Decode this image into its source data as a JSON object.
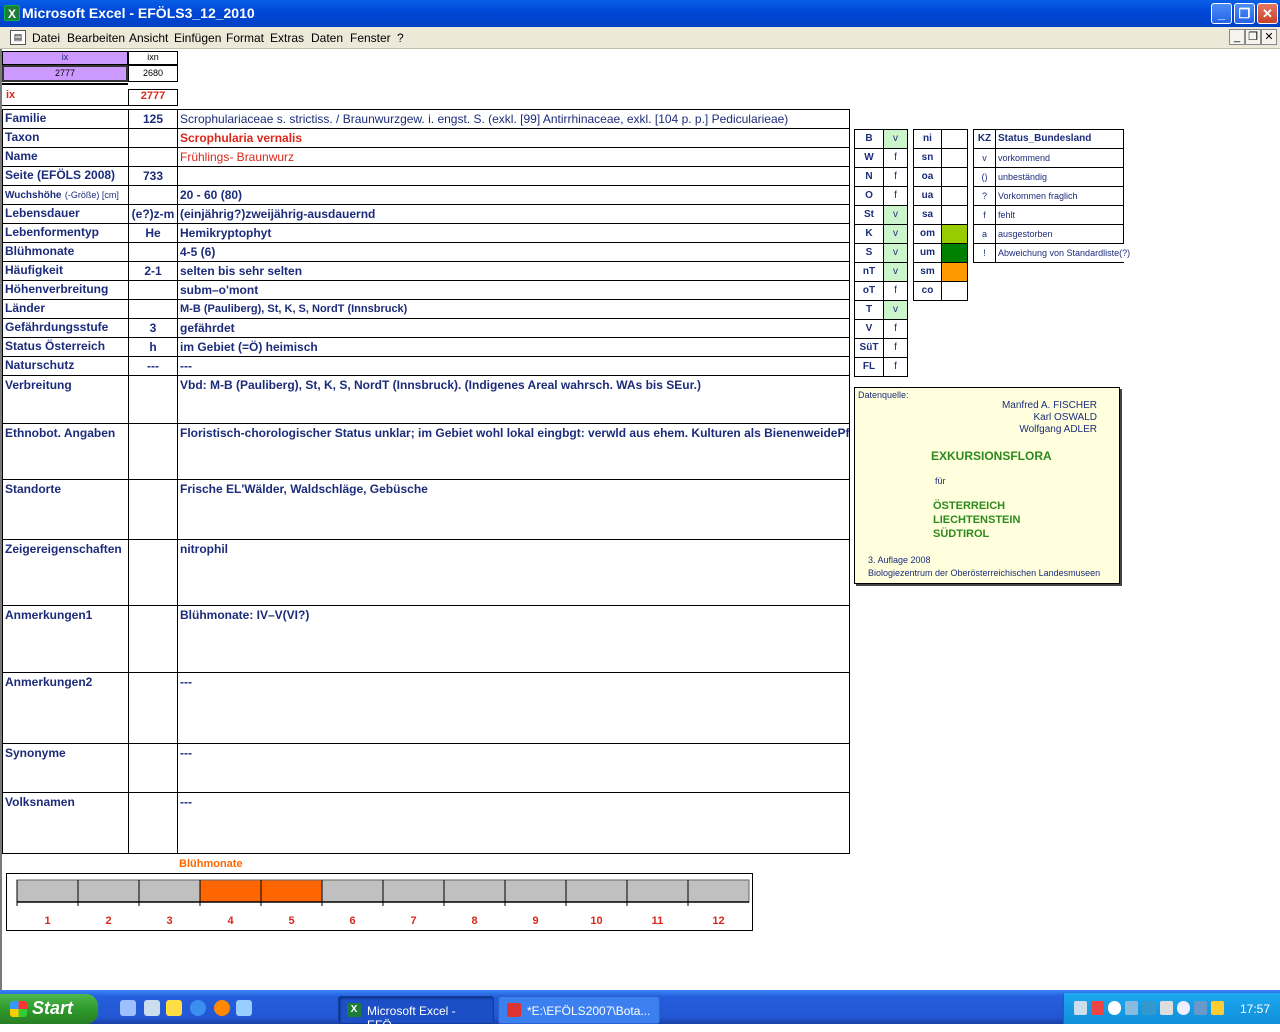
{
  "window": {
    "title": "Microsoft Excel - EFÖLS3_12_2010",
    "app_icon": "X"
  },
  "menu": [
    "Datei",
    "Bearbeiten",
    "Ansicht",
    "Einfügen",
    "Format",
    "Extras",
    "Daten",
    "Fenster",
    "?"
  ],
  "top": {
    "ix_header": "ix",
    "ixn_header": "ixn",
    "ix_value": "2777",
    "ixn_value": "2680",
    "ix_label": "ix",
    "ix_red": "2777"
  },
  "rows": [
    {
      "label": "Familie",
      "code": "125",
      "value": "Scrophulariaceae s. strictiss.  /  Braunwurzgew. i. engst. S. (exkl. [99] Antirrhinaceae, exkl. [104 p. p.] Pedicularieae)"
    },
    {
      "label": "Taxon",
      "code": "",
      "value": "Scrophularia vernalis"
    },
    {
      "label": "Name",
      "code": "",
      "value": "Frühlings- Braunwurz"
    },
    {
      "label": "Seite (EFÖLS 2008)",
      "code": "733",
      "value": ""
    },
    {
      "label": "Wuchshöhe",
      "label_small": "(-Größe) [cm]",
      "code": "",
      "value": " 20 - 60 (80)"
    },
    {
      "label": "Lebensdauer",
      "code": "(e?)z-m",
      "value": "(einjährig?)zweijährig-ausdauernd"
    },
    {
      "label": "Lebenformentyp",
      "code": "He",
      "value": "Hemikryptophyt"
    },
    {
      "label": "Blühmonate",
      "code": "",
      "value": " 4-5 (6)"
    },
    {
      "label": "Häufigkeit",
      "code": "2-1",
      "value": "selten bis sehr selten"
    },
    {
      "label": "Höhenverbreitung",
      "code": "",
      "value": "subm–o'mont"
    },
    {
      "label": "Länder",
      "code": "",
      "value": " M-B (Pauliberg), St, K, S, NordT (Innsbruck)"
    },
    {
      "label": "Gefährdungsstufe",
      "code": "3",
      "value": "gefährdet"
    },
    {
      "label": "Status Österreich",
      "code": "h",
      "value": "im Gebiet (=Ö) heimisch"
    },
    {
      "label": "Naturschutz",
      "code": "---",
      "value": " ---"
    }
  ],
  "big_rows": [
    {
      "label": "Verbreitung",
      "value": "Vbd: M-B (Pauliberg), St, K, S, NordT (Innsbruck). (Indigenes Areal wahrsch. WAs bis SEur.)"
    },
    {
      "label": "Ethnobot. Angaben",
      "value": "Floristisch-chorologischer Status unklar; im Gebiet wohl lokal eingbgt: verwld aus ehem. Kulturen als BienenweidePf."
    },
    {
      "label": "Standorte",
      "value": "Frische EL'Wälder, Waldschläge, Gebüsche"
    },
    {
      "label": "Zeigereigenschaften",
      "value": "nitrophil"
    },
    {
      "label": "Anmerkungen1",
      "value": "Blühmonate: IV–V(VI?)"
    },
    {
      "label": "Anmerkungen2",
      "value": "---"
    },
    {
      "label": "Synonyme",
      "value": "---"
    },
    {
      "label": "Volksnamen",
      "value": "---"
    }
  ],
  "states": [
    {
      "kz": "B",
      "v": "v"
    },
    {
      "kz": "W",
      "v": "f"
    },
    {
      "kz": "N",
      "v": "f"
    },
    {
      "kz": "O",
      "v": "f"
    },
    {
      "kz": "St",
      "v": "v"
    },
    {
      "kz": "K",
      "v": "v"
    },
    {
      "kz": "S",
      "v": "v"
    },
    {
      "kz": "nT",
      "v": "v"
    },
    {
      "kz": "oT",
      "v": "f"
    },
    {
      "kz": "T",
      "v": "v"
    },
    {
      "kz": "V",
      "v": "f"
    },
    {
      "kz": "SüT",
      "v": "f"
    },
    {
      "kz": "FL",
      "v": "f"
    }
  ],
  "altitude": [
    {
      "k": "ni",
      "color": "#ffffff"
    },
    {
      "k": "sn",
      "color": "#ffffff"
    },
    {
      "k": "oa",
      "color": "#ffffff"
    },
    {
      "k": "ua",
      "color": "#ffffff"
    },
    {
      "k": "sa",
      "color": "#ffffff"
    },
    {
      "k": "om",
      "color": "#99cc00"
    },
    {
      "k": "um",
      "color": "#008000"
    },
    {
      "k": "sm",
      "color": "#ff9900"
    },
    {
      "k": "co",
      "color": "#ffffff"
    }
  ],
  "legend": {
    "kz_header": "KZ",
    "status_header": "Status_Bundesland",
    "items": [
      {
        "k": "v",
        "t": "vorkommend"
      },
      {
        "k": "()",
        "t": "unbeständig"
      },
      {
        "k": "?",
        "t": "Vorkommen fraglich"
      },
      {
        "k": "f",
        "t": "fehlt"
      },
      {
        "k": "a",
        "t": "ausgestorben"
      },
      {
        "k": "!",
        "t": "Abweichung von Standardliste(?)"
      }
    ]
  },
  "source": {
    "label": "Datenquelle:",
    "authors": [
      "Manfred A. FISCHER",
      "Karl OSWALD",
      "Wolfgang ADLER"
    ],
    "title": "EXKURSIONSFLORA",
    "fuer": "für",
    "regions": [
      "ÖSTERREICH",
      "LIECHTENSTEIN",
      "SÜDTIROL"
    ],
    "edition": "3. Auflage 2008",
    "publisher": "Biologiezentrum der Oberösterreichischen Landesmuseen"
  },
  "months_chart": {
    "title": "Blühmonate",
    "labels": [
      "1",
      "2",
      "3",
      "4",
      "5",
      "6",
      "7",
      "8",
      "9",
      "10",
      "11",
      "12"
    ],
    "active": [
      false,
      false,
      false,
      true,
      true,
      false,
      false,
      false,
      false,
      false,
      false,
      false
    ],
    "active_color": "#ff6600",
    "inactive_color": "#c0c0c0"
  },
  "taskbar": {
    "start": "Start",
    "buttons": [
      "Microsoft Excel - EFÖ...",
      "*E:\\EFÖLS2007\\Bota..."
    ],
    "clock": "17:57"
  }
}
